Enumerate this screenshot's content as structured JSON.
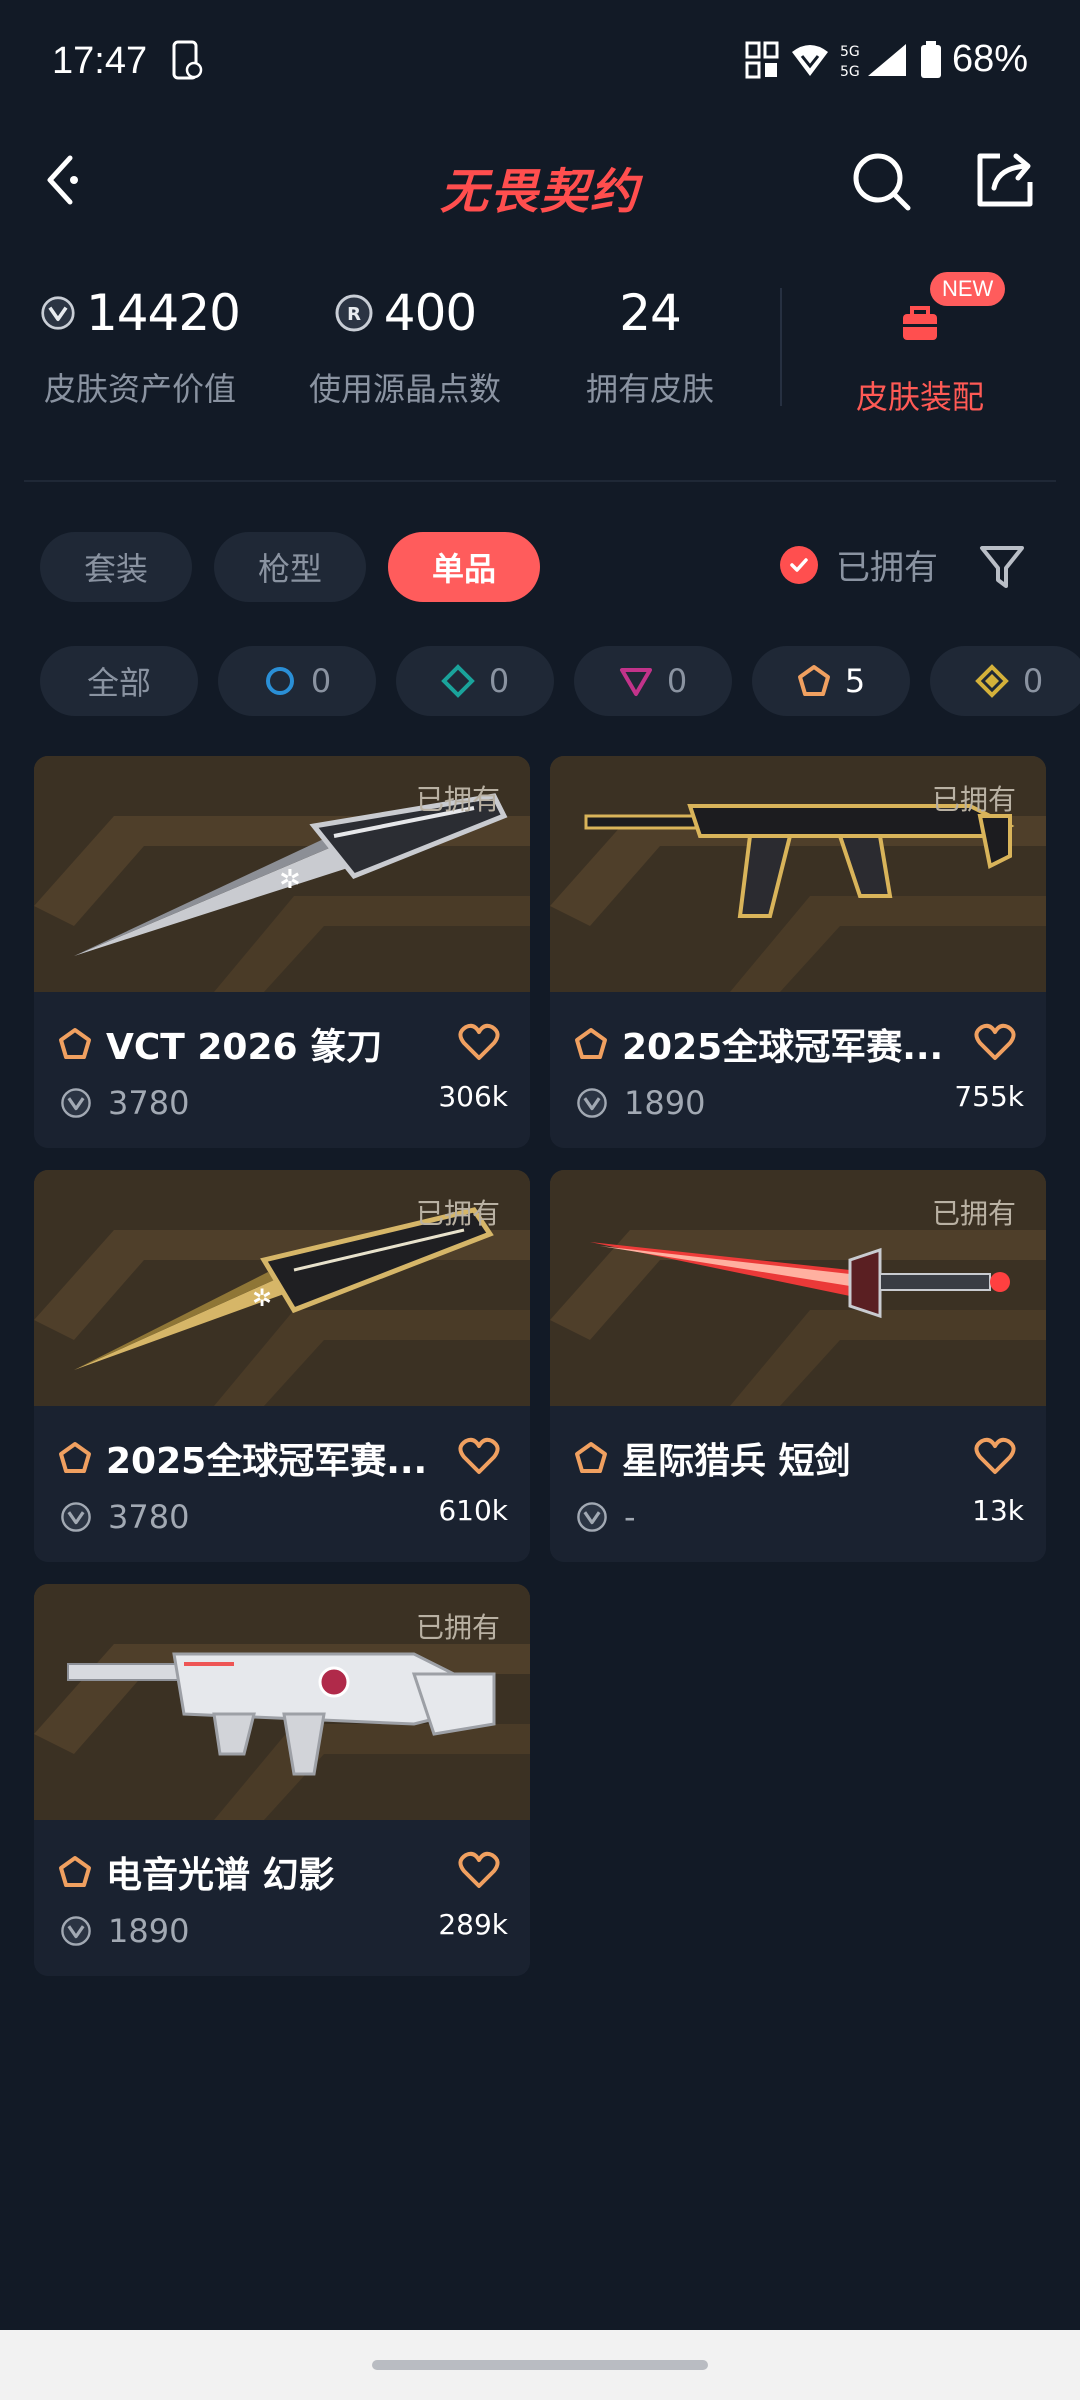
{
  "status_bar": {
    "time": "17:47",
    "battery": "68%",
    "network": "5G"
  },
  "header": {
    "title": "无畏契约"
  },
  "stats": [
    {
      "value": "14420",
      "label": "皮肤资产价值",
      "icon": "vp-coin-icon"
    },
    {
      "value": "400",
      "label": "使用源晶点数",
      "icon": "radianite-icon"
    },
    {
      "value": "24",
      "label": "拥有皮肤",
      "icon": ""
    }
  ],
  "equip": {
    "label": "皮肤装配",
    "badge": "NEW"
  },
  "tabs": [
    {
      "label": "套装",
      "active": false
    },
    {
      "label": "枪型",
      "active": false
    },
    {
      "label": "单品",
      "active": true
    }
  ],
  "owned_filter": {
    "label": "已拥有",
    "checked": true
  },
  "rarity_filters": [
    {
      "label": "全部",
      "count": "",
      "tier": "all",
      "color": ""
    },
    {
      "label": "",
      "count": "0",
      "tier": "select",
      "color": "#2a8fd6"
    },
    {
      "label": "",
      "count": "0",
      "tier": "deluxe",
      "color": "#1aa39b"
    },
    {
      "label": "",
      "count": "0",
      "tier": "premium",
      "color": "#c2338a"
    },
    {
      "label": "",
      "count": "5",
      "tier": "exclusive",
      "color": "#f0a060"
    },
    {
      "label": "",
      "count": "0",
      "tier": "ultra",
      "color": "#d4b13a"
    }
  ],
  "items": [
    {
      "name": "VCT 2026 篆刀",
      "price": "3780",
      "likes": "306k",
      "owned": "已拥有",
      "type": "knife"
    },
    {
      "name": "2025全球冠军赛...",
      "price": "1890",
      "likes": "755k",
      "owned": "已拥有",
      "type": "rifle-gold"
    },
    {
      "name": "2025全球冠军赛...",
      "price": "3780",
      "likes": "610k",
      "owned": "已拥有",
      "type": "knife-gold"
    },
    {
      "name": "星际猎兵 短剑",
      "price": "-",
      "likes": "13k",
      "owned": "已拥有",
      "type": "sword-red"
    },
    {
      "name": "电音光谱 幻影",
      "price": "1890",
      "likes": "289k",
      "owned": "已拥有",
      "type": "rifle-white"
    }
  ],
  "colors": {
    "accent": "#ff5c5c",
    "background": "#121a26",
    "card": "#1a2230",
    "rarity_exclusive": "#f0a060"
  }
}
